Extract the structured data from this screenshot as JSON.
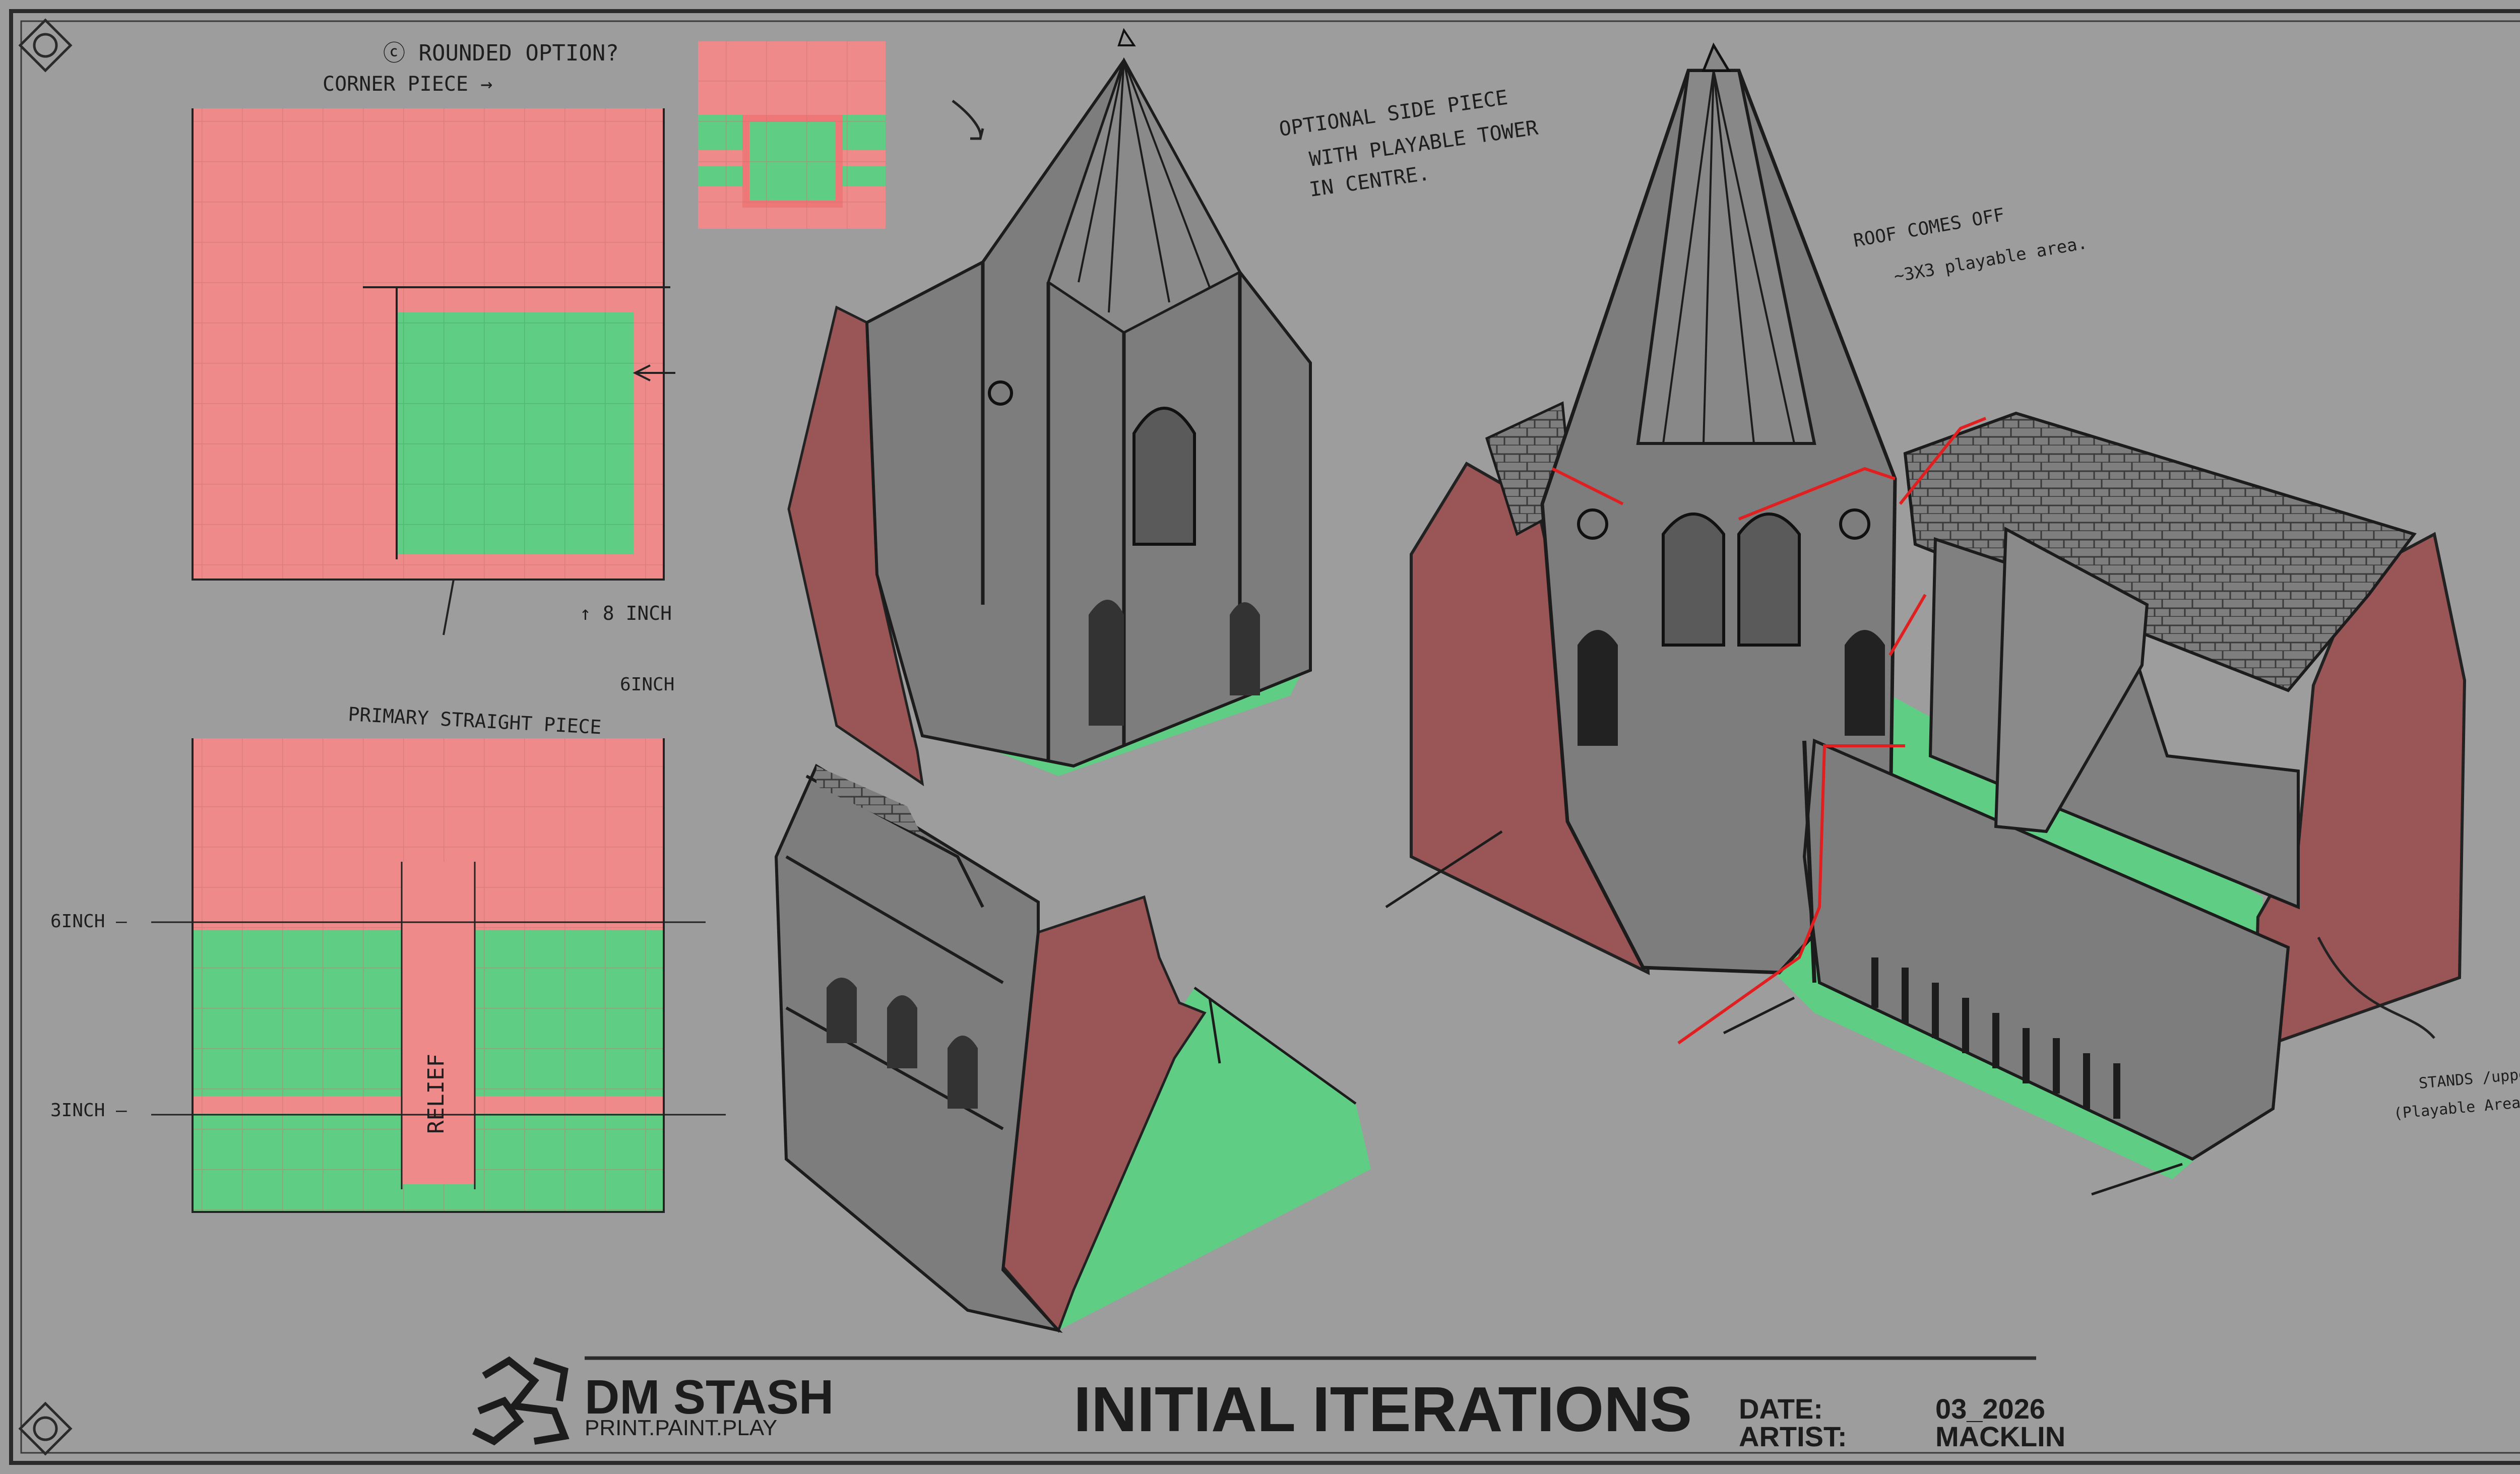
{
  "notes": {
    "rounded_option": "ⓒ ROUNDED OPTION?",
    "corner_piece": "CORNER PIECE →",
    "optional_side_line1": "OPTIONAL SIDE PIECE",
    "optional_side_line2": "WITH PLAYABLE TOWER",
    "optional_side_line3": "IN CENTRE.",
    "roof_line1": "ROOF COMES OFF",
    "roof_line2": "~3X3 playable area.",
    "eight_inch": "↑ 8 INCH",
    "six_inch": "6INCH",
    "primary_straight": "PRIMARY STRAIGHT PIECE",
    "left_6inch": "6INCH —",
    "left_3inch": "3INCH —",
    "relief": "RELIEF",
    "stands_line1": "STANDS /upper level",
    "stands_line2": "(Playable Area)"
  },
  "footer": {
    "brand_name": "DM STASH",
    "brand_tagline": "PRINT.PAINT.PLAY",
    "title": "INITIAL ITERATIONS",
    "date_label": "DATE:",
    "date_value": "03_2026",
    "artist_label": "ARTIST:",
    "artist_value": "MACKLIN"
  },
  "colors": {
    "background": "#9d9d9d",
    "pink": "#ee8a8a",
    "green": "#5fce84",
    "wall_red": "#9a5656",
    "stone": "#7d7d7d",
    "ink": "#1c1c1c",
    "red_line": "#e02020"
  }
}
